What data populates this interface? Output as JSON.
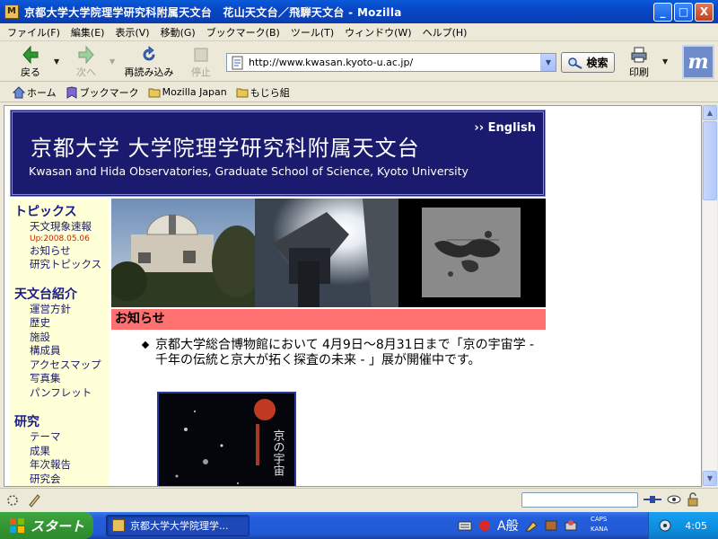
{
  "window": {
    "title": "京都大学大学院理学研究科附属天文台　花山天文台／飛騨天文台 - Mozilla",
    "app_icon_glyph": "M",
    "minimize": "_",
    "maximize": "□",
    "close": "X"
  },
  "menu": [
    "ファイル(F)",
    "編集(E)",
    "表示(V)",
    "移動(G)",
    "ブックマーク(B)",
    "ツール(T)",
    "ウィンドウ(W)",
    "ヘルプ(H)"
  ],
  "toolbar": {
    "back": "戻る",
    "forward": "次へ",
    "reload": "再読み込み",
    "stop": "停止",
    "url": "http://www.kwasan.kyoto-u.ac.jp/",
    "search": "検索",
    "print": "印刷",
    "logo_glyph": "m"
  },
  "bookmarks": [
    {
      "label": "ホーム",
      "icon": "home-icon"
    },
    {
      "label": "ブックマーク",
      "icon": "bookmarks-icon"
    },
    {
      "label": "Mozilla Japan",
      "icon": "folder-icon"
    },
    {
      "label": "もじら組",
      "icon": "folder-icon"
    }
  ],
  "site": {
    "title_ja": "京都大学 大学院理学研究科附属天文台",
    "title_en": "Kwasan and Hida Observatories, Graduate School of Science, Kyoto University",
    "english_link": "English",
    "english_link_marker": "››"
  },
  "sidebar": {
    "sections": [
      {
        "heading": "トピックス",
        "items": [
          "天文現象速報",
          "お知らせ",
          "研究トピックス"
        ],
        "update_label": "Up:2008.05.06"
      },
      {
        "heading": "天文台紹介",
        "items": [
          "運営方針",
          "歴史",
          "施設",
          "構成員",
          "アクセスマップ",
          "写真集",
          "パンフレット"
        ]
      },
      {
        "heading": "研究",
        "items": [
          "テーマ",
          "成果",
          "年次報告",
          "研究会"
        ]
      }
    ]
  },
  "notice": {
    "heading": "お知らせ",
    "items": [
      "京都大学総合博物館において 4月9日～8月31日まで「京の宇宙学 - 千年の伝統と京大が拓く探査の未来 - 」展が開催中です。"
    ],
    "poster_text": "京の宇宙"
  },
  "taskbar": {
    "start": "スタート",
    "task": "京都大学大学院理学...",
    "ime_mode": "A般",
    "caps": "CAPS",
    "kana": "KANA",
    "clock": "4:05"
  },
  "colors": {
    "header_bg": "#1a1a6e",
    "sidebar_bg": "#ffffd8",
    "notice_bar": "#ff7070",
    "link": "#1a1a6a",
    "update_date": "#cc2200"
  }
}
